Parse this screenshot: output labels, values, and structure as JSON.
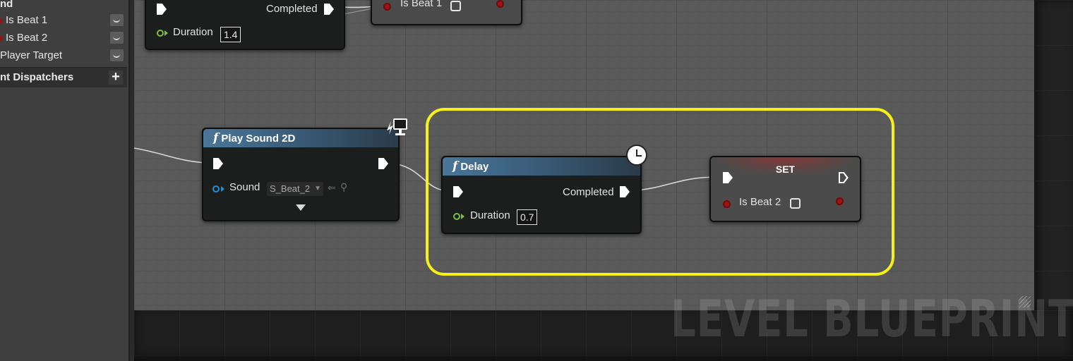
{
  "left_panel": {
    "partial_header": "nd",
    "variables": [
      {
        "label": "Is Beat 1"
      },
      {
        "label": "Is Beat 2"
      },
      {
        "label": "Player Target"
      }
    ],
    "section": {
      "label": "nt Dispatchers",
      "add_label": "+"
    }
  },
  "graph": {
    "watermark": "LEVEL BLUEPRINT",
    "top_delay_node": {
      "completed_label": "Completed",
      "duration_label": "Duration",
      "duration_value": "1.4"
    },
    "top_set_node": {
      "pin_label": "Is Beat 1"
    },
    "play_sound_node": {
      "title": "Play Sound 2D",
      "sound_label": "Sound",
      "sound_value": "S_Beat_2",
      "function_glyph": "f"
    },
    "delay_node": {
      "title": "Delay",
      "completed_label": "Completed",
      "duration_label": "Duration",
      "duration_value": "0.7",
      "function_glyph": "f"
    },
    "set_node": {
      "title": "SET",
      "pin_label": "Is Beat 2"
    }
  },
  "colors": {
    "highlight": "#f5f01a",
    "float_pin": "#7ac143",
    "object_pin": "#1d8fe0",
    "bool_pin": "#a01313",
    "function_header": "#4a7699"
  }
}
